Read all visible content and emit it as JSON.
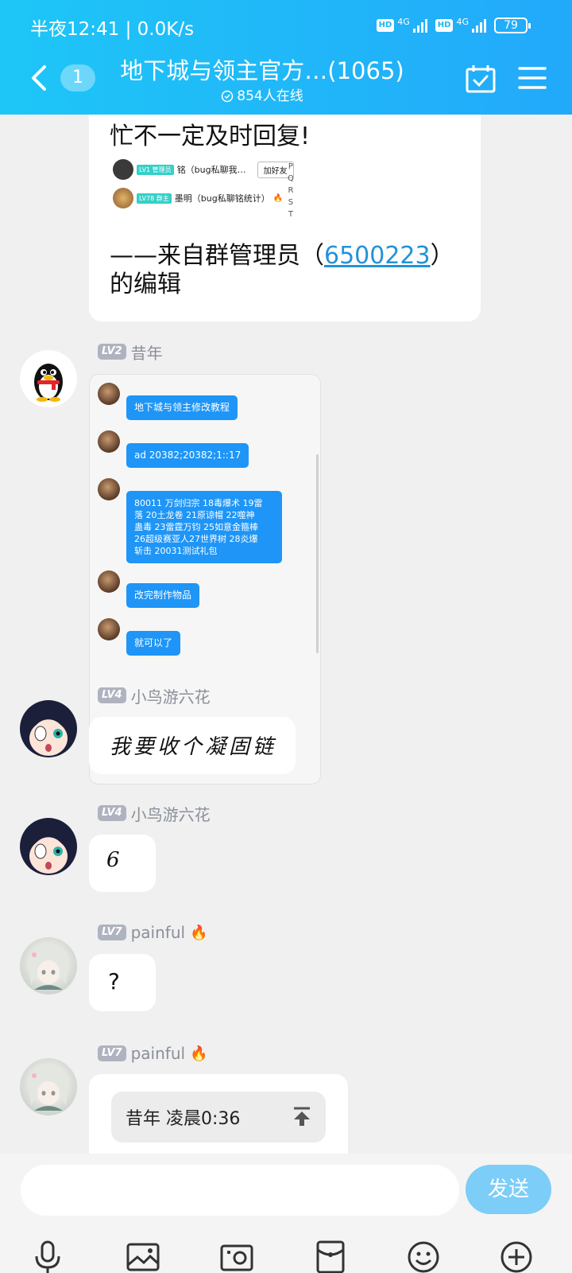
{
  "status_bar": {
    "time": "半夜12:41 | 0.0K/s",
    "network1": "4G",
    "network2": "4G",
    "hd": "HD",
    "battery": "79"
  },
  "header": {
    "unread_count": "1",
    "title": "地下城与领主官方…(1065)",
    "online": "854人在线"
  },
  "messages": {
    "notice": {
      "line1": "忙不一定及时回复!",
      "footer_prefix": "——来自群管理员（",
      "footer_link": "6500223",
      "footer_suffix": "）",
      "footer_line2": "的编辑",
      "mini_rows": [
        {
          "tag": "LV1 管理员",
          "text": "铭（bug私聊我…",
          "button": "加好友"
        },
        {
          "tag": "LV78 群主",
          "text": "墨明（bug私聊铭统计）"
        }
      ],
      "alphabet": [
        "P",
        "Q",
        "R",
        "S",
        "T"
      ]
    },
    "m1": {
      "level": "LV2",
      "nickname": "昔年",
      "screenshot_bubbles": [
        "地下城与领主修改教程",
        "ad 20382;20382;1::17",
        "80011 万剑归宗 18毒爆术 19雷\n落 20土龙卷  21原谅帽 22噬神\n蛊毒  23雷霆万钧 25如意金箍棒\n26超级赛亚人27世界树 28炎爆\n斩击  20031测试礼包",
        "改完制作物品",
        "就可以了"
      ]
    },
    "m2": {
      "level": "LV4",
      "nickname": "小鸟游六花",
      "text": "我要收个凝固链"
    },
    "m3": {
      "level": "LV4",
      "nickname": "小鸟游六花",
      "text": "6"
    },
    "m4": {
      "level": "LV7",
      "nickname": "painful",
      "text": "?"
    },
    "m5": {
      "level": "LV7",
      "nickname": "painful",
      "quote": "昔年 凌晨0:36"
    }
  },
  "input": {
    "placeholder": "",
    "send_label": "发送"
  },
  "toolbar": [
    "mic-icon",
    "image-icon",
    "camera-icon",
    "red-packet-icon",
    "emoji-icon",
    "plus-icon"
  ],
  "colors": {
    "header_start": "#1ec6f7",
    "header_end": "#22a9fa",
    "send_button": "#7ccdf8",
    "chat_bg": "#f0f0f0",
    "link": "#2492d8"
  }
}
